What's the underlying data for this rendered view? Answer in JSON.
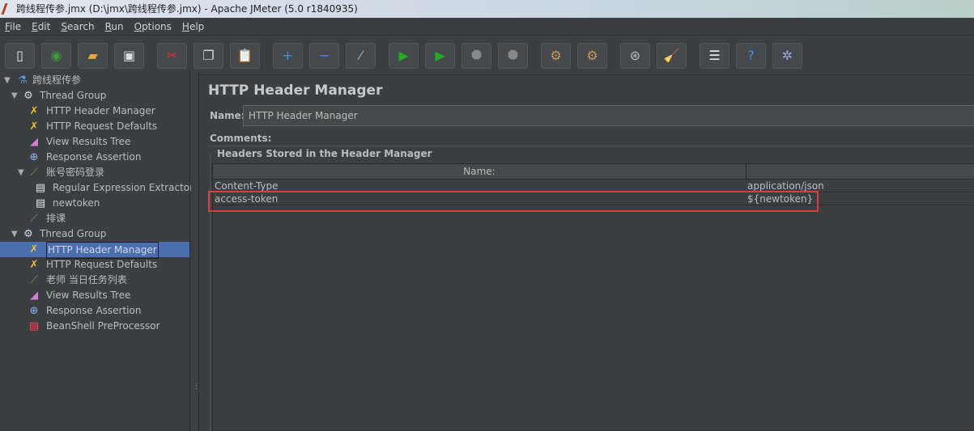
{
  "window": {
    "title": "跨线程传参.jmx (D:\\jmx\\跨线程传参.jmx) - Apache JMeter (5.0 r1840935)"
  },
  "menu": [
    "File",
    "Edit",
    "Search",
    "Run",
    "Options",
    "Help"
  ],
  "toolbar": [
    {
      "name": "new-icon",
      "glyph": "▯",
      "color": "#f0f0f0"
    },
    {
      "name": "templates-icon",
      "glyph": "◉",
      "color": "#3a9a3a"
    },
    {
      "name": "open-icon",
      "glyph": "▰",
      "color": "#e8a73a"
    },
    {
      "name": "save-icon",
      "glyph": "▣",
      "color": "#dddddd"
    },
    {
      "name": "cut-icon",
      "glyph": "✂",
      "color": "#e03030"
    },
    {
      "name": "copy-icon",
      "glyph": "❐",
      "color": "#dddddd"
    },
    {
      "name": "paste-icon",
      "glyph": "📋",
      "color": "#d9a85a"
    },
    {
      "name": "expand-icon",
      "glyph": "+",
      "color": "#4a90e2"
    },
    {
      "name": "collapse-icon",
      "glyph": "−",
      "color": "#4a90e2"
    },
    {
      "name": "toggle-icon",
      "glyph": "⁄",
      "color": "#8fb8d8"
    },
    {
      "name": "start-icon",
      "glyph": "▶",
      "color": "#22aa22"
    },
    {
      "name": "start-no-pauses-icon",
      "glyph": "▶",
      "color": "#22aa22"
    },
    {
      "name": "stop-icon",
      "glyph": "⯃",
      "color": "#888888"
    },
    {
      "name": "shutdown-icon",
      "glyph": "⯃",
      "color": "#888888"
    },
    {
      "name": "clear-icon",
      "glyph": "⚙",
      "color": "#c89a60"
    },
    {
      "name": "clear-all-icon",
      "glyph": "⚙",
      "color": "#c89a60"
    },
    {
      "name": "search-icon",
      "glyph": "⊛",
      "color": "#bbbbbb"
    },
    {
      "name": "reset-search-icon",
      "glyph": "🧹",
      "color": "#e8b030"
    },
    {
      "name": "function-helper-icon",
      "glyph": "☰",
      "color": "#eeeeee"
    },
    {
      "name": "help-icon",
      "glyph": "?",
      "color": "#4a90e2"
    },
    {
      "name": "remote-icon",
      "glyph": "✲",
      "color": "#9aaae8"
    }
  ],
  "tree": [
    {
      "label": "跨线程传参",
      "icon": "flask",
      "glyph": "⚗",
      "color": "#5b8fd8",
      "level": 0,
      "expanded": true
    },
    {
      "label": "Thread Group",
      "icon": "gear",
      "glyph": "⚙",
      "color": "#cfd8e8",
      "level": 1,
      "expanded": true
    },
    {
      "label": "HTTP Header Manager",
      "icon": "wrench",
      "glyph": "✗",
      "color": "#e8c030",
      "level": 2
    },
    {
      "label": "HTTP Request Defaults",
      "icon": "wrench",
      "glyph": "✗",
      "color": "#e8c030",
      "level": 2
    },
    {
      "label": "View Results Tree",
      "icon": "chart",
      "glyph": "◢",
      "color": "#d080d0",
      "level": 2
    },
    {
      "label": "Response Assertion",
      "icon": "magnifier",
      "glyph": "⊕",
      "color": "#8ab8e8",
      "level": 2
    },
    {
      "label": "账号密码登录",
      "icon": "pipette",
      "glyph": "⟋",
      "color": "#60b040",
      "level": 2,
      "expanded": true
    },
    {
      "label": "Regular Expression Extractor",
      "icon": "extractor",
      "glyph": "▤",
      "color": "#e8e8e8",
      "level": 3
    },
    {
      "label": "newtoken",
      "icon": "extractor",
      "glyph": "▤",
      "color": "#e8e8e8",
      "level": 3
    },
    {
      "label": "排课",
      "icon": "pipette",
      "glyph": "⟋",
      "color": "#60b040",
      "level": 2
    },
    {
      "label": "Thread Group",
      "icon": "gear",
      "glyph": "⚙",
      "color": "#cfd8e8",
      "level": 1,
      "expanded": true
    },
    {
      "label": "HTTP Header Manager",
      "icon": "wrench",
      "glyph": "✗",
      "color": "#e8c030",
      "level": 2,
      "selected": true
    },
    {
      "label": "HTTP Request Defaults",
      "icon": "wrench",
      "glyph": "✗",
      "color": "#e8c030",
      "level": 2
    },
    {
      "label": "老师 当日任务列表",
      "icon": "pipette",
      "glyph": "⟋",
      "color": "#60b040",
      "level": 2
    },
    {
      "label": "View Results Tree",
      "icon": "chart",
      "glyph": "◢",
      "color": "#d080d0",
      "level": 2
    },
    {
      "label": "Response Assertion",
      "icon": "magnifier",
      "glyph": "⊕",
      "color": "#8ab8e8",
      "level": 2
    },
    {
      "label": "BeanShell PreProcessor",
      "icon": "preprocessor",
      "glyph": "▤",
      "color": "#e05050",
      "level": 2
    }
  ],
  "panel": {
    "title": "HTTP Header Manager",
    "name_label": "Name:",
    "name_value": "HTTP Header Manager",
    "comments_label": "Comments:",
    "group_title": "Headers Stored in the Header Manager",
    "columns": [
      "Name:",
      ""
    ],
    "rows": [
      [
        "Content-Type",
        "application/json"
      ],
      [
        "access-token",
        "${newtoken}"
      ]
    ],
    "highlight_color": "#e03a3e"
  }
}
